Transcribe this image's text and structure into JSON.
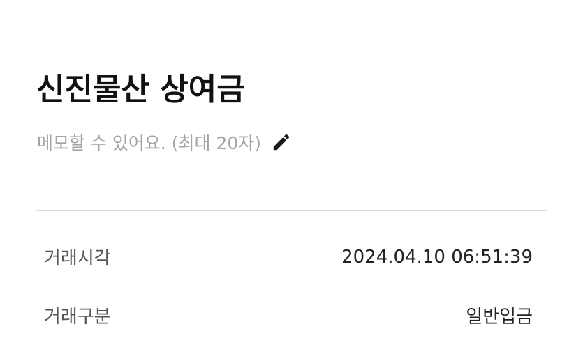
{
  "account": {
    "title": "신진물산 상여금"
  },
  "memo": {
    "placeholder": "메모할 수 있어요. (최대 20자)",
    "edit_icon": "pencil-icon"
  },
  "details": {
    "rows": [
      {
        "label": "거래시각",
        "value": "2024.04.10 06:51:39"
      },
      {
        "label": "거래구분",
        "value": "일반입금"
      }
    ]
  },
  "colors": {
    "title": "#111111",
    "memo_placeholder": "#a3a3a3",
    "divider": "#d9d9d9",
    "label": "#555555",
    "value": "#222222"
  }
}
